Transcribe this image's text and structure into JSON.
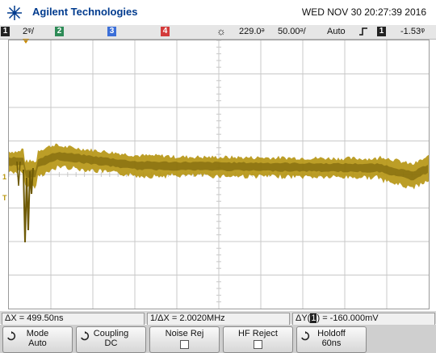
{
  "header": {
    "brand": "Agilent Technologies",
    "datetime": "WED NOV 30 20:27:39 2016",
    "logo_icon": "agilent-spark-logo"
  },
  "status": {
    "ch1_num": "1",
    "ch1_scale": "2ᵠ/",
    "ch2_num": "2",
    "ch3_num": "3",
    "ch4_num": "4",
    "run_icon": "trigger-sun-icon",
    "time_delay": "229.0ᵊ",
    "time_base": "50.00ᵊ/",
    "trigger_mode": "Auto",
    "trigger_slope_icon": "rising-edge-icon",
    "trigger_source": "1",
    "trigger_level": "-1.53ᵠ"
  },
  "measurements": {
    "delta_x": "ΔX = 499.50ns",
    "inv_delta_x": "1/ΔX = 2.0020MHz",
    "delta_y_prefix": "ΔY(",
    "delta_y_ch": "1",
    "delta_y_suffix": ") = -160.000mV"
  },
  "softkeys": [
    {
      "line1": "Mode",
      "line2": "Auto",
      "icon": "rotate-knob-icon"
    },
    {
      "line1": "Coupling",
      "line2": "DC",
      "icon": "rotate-knob-icon"
    },
    {
      "line1": "Noise Rej",
      "line2": "",
      "icon": "checkbox-icon"
    },
    {
      "line1": "HF Reject",
      "line2": "",
      "icon": "checkbox-icon"
    },
    {
      "line1": "Holdoff",
      "line2": "60ns",
      "icon": "rotate-knob-icon"
    }
  ],
  "markers": {
    "ch1_ground": "1",
    "trigger_level": "T"
  },
  "colors": {
    "trace": "#b59410",
    "ch1": "#c9a400",
    "ch2": "#2e8b57",
    "ch3": "#3b6fd8",
    "ch4": "#d33a3a",
    "grid": "#c8c8c8"
  }
}
